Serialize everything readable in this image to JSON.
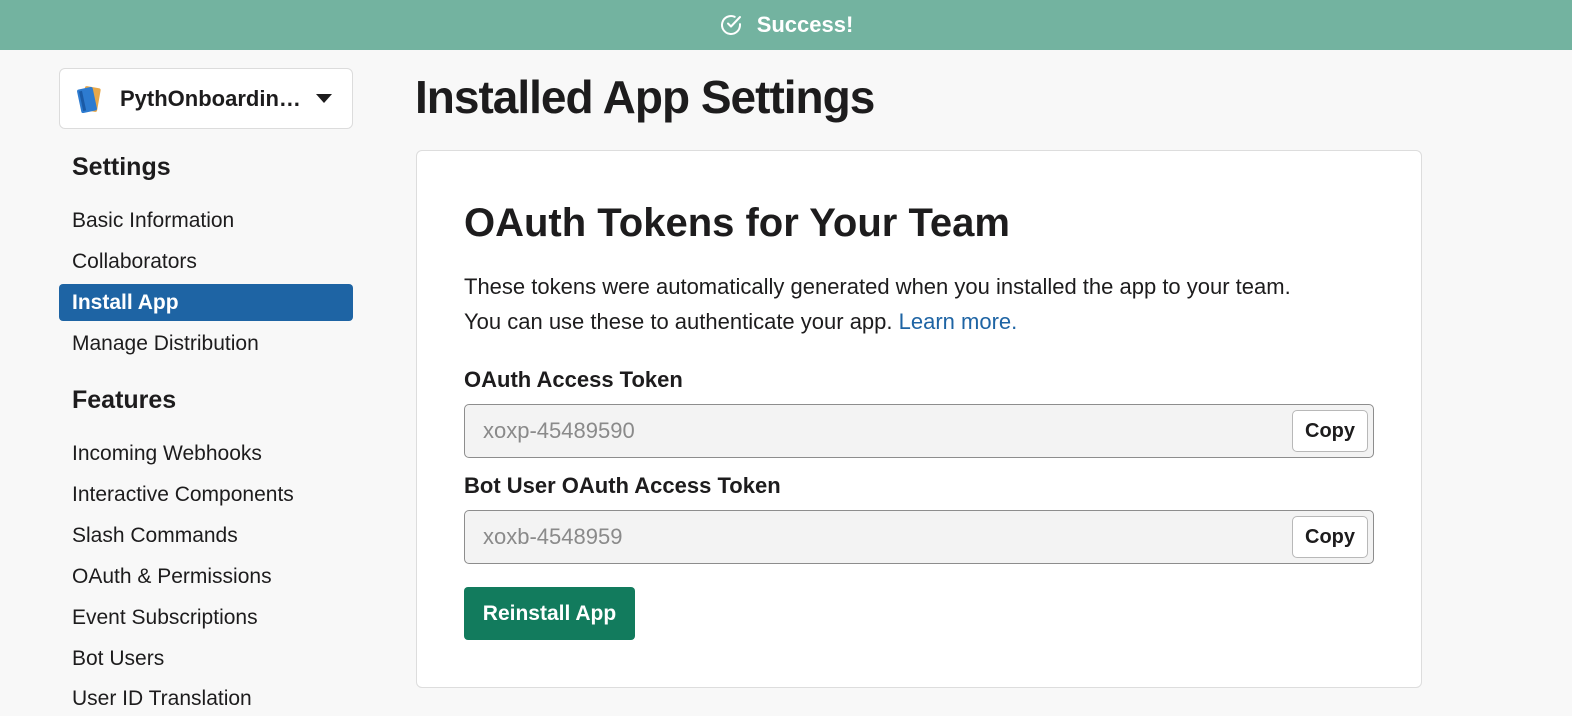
{
  "banner": {
    "text": "Success!"
  },
  "app_selector": {
    "name": "PythOnboardin…"
  },
  "sidebar": {
    "settings_heading": "Settings",
    "settings_items": [
      {
        "label": "Basic Information"
      },
      {
        "label": "Collaborators"
      },
      {
        "label": "Install App",
        "active": true
      },
      {
        "label": "Manage Distribution"
      }
    ],
    "features_heading": "Features",
    "features_items": [
      {
        "label": "Incoming Webhooks"
      },
      {
        "label": "Interactive Components"
      },
      {
        "label": "Slash Commands"
      },
      {
        "label": "OAuth & Permissions"
      },
      {
        "label": "Event Subscriptions"
      },
      {
        "label": "Bot Users"
      },
      {
        "label": "User ID Translation"
      }
    ]
  },
  "main": {
    "page_title": "Installed App Settings",
    "card": {
      "title": "OAuth Tokens for Your Team",
      "description_line1": "These tokens were automatically generated when you installed the app to your team.",
      "description_line2": "You can use these to authenticate your app.",
      "learn_more": "Learn more.",
      "oauth_token": {
        "label": "OAuth Access Token",
        "value_visible": "xoxp-45489590",
        "copy_label": "Copy"
      },
      "bot_token": {
        "label": "Bot User OAuth Access Token",
        "value_visible": "xoxb-4548959",
        "copy_label": "Copy"
      },
      "reinstall_label": "Reinstall App"
    }
  },
  "colors": {
    "banner": "#73b3a0",
    "active_nav": "#1e64a4",
    "link": "#1e64a4",
    "primary_button": "#127b5d"
  }
}
